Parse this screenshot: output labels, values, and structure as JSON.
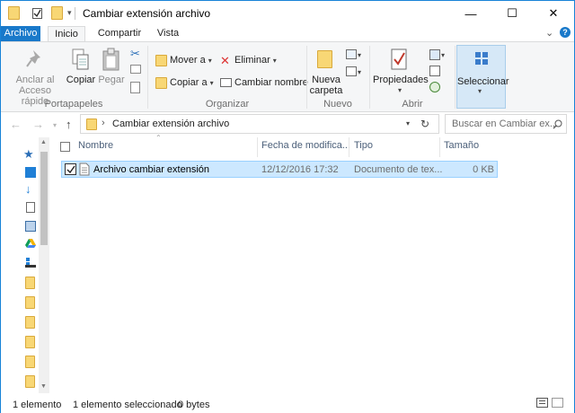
{
  "window": {
    "title": "Cambiar extensión archivo",
    "minimize_glyph": "—",
    "maximize_glyph": "☐",
    "close_glyph": "✕",
    "help_glyph": "?",
    "collapse_glyph": "⌄"
  },
  "tabs": [
    "Archivo",
    "Inicio",
    "Compartir",
    "Vista"
  ],
  "ribbon": {
    "portapapeles": {
      "label": "Portapapeles",
      "pin_label_1": "Anclar al",
      "pin_label_2": "Acceso rápido",
      "copy_label": "Copiar",
      "paste_label": "Pegar"
    },
    "organizar": {
      "label": "Organizar",
      "move_to": "Mover a",
      "copy_to": "Copiar a",
      "delete": "Eliminar",
      "rename": "Cambiar nombre"
    },
    "nuevo": {
      "label": "Nuevo",
      "new_folder_1": "Nueva",
      "new_folder_2": "carpeta"
    },
    "abrir": {
      "label": "Abrir",
      "properties": "Propiedades"
    },
    "seleccionar": {
      "label": "Seleccionar"
    }
  },
  "address": {
    "path": "Cambiar extensión archivo",
    "search_placeholder": "Buscar en Cambiar ex..."
  },
  "columns": [
    "Nombre",
    "Fecha de modifica...",
    "Tipo",
    "Tamaño"
  ],
  "files": [
    {
      "name": "Archivo cambiar extensión",
      "date": "12/12/2016 17:32",
      "type": "Documento de tex...",
      "size": "0 KB"
    }
  ],
  "status": {
    "count": "1 elemento",
    "selected": "1 elemento seleccionado",
    "size": "0 bytes"
  },
  "colors": {
    "accent": "#1979ca",
    "selection": "#cce8ff",
    "folder": "#f8d775"
  }
}
